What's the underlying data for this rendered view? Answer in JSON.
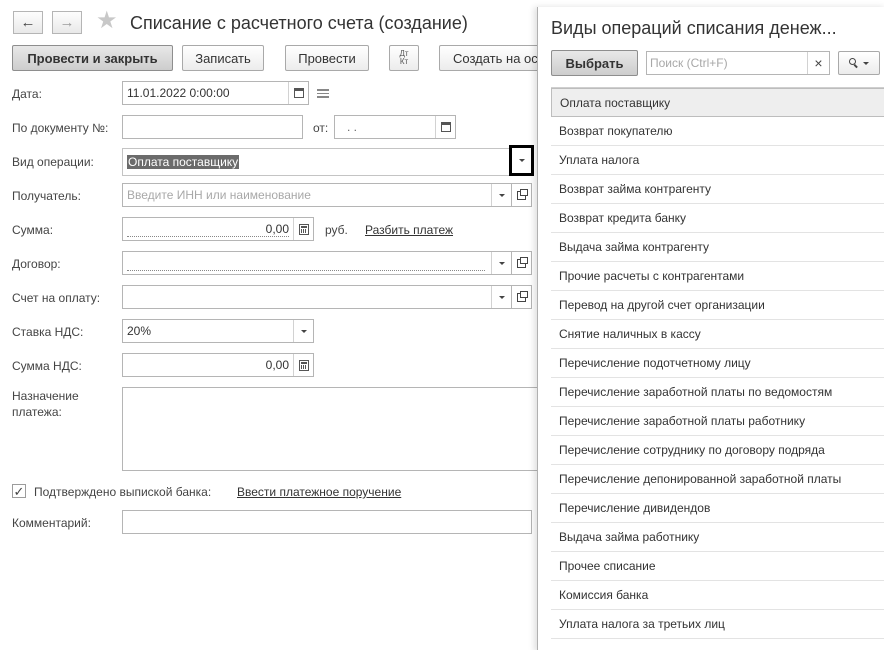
{
  "header": {
    "title": "Списание с расчетного счета (создание)",
    "back_icon": "←",
    "forward_icon": "→"
  },
  "toolbar": {
    "post_and_close": "Провести и закрыть",
    "save": "Записать",
    "post": "Провести",
    "dt_label": "Дт",
    "kt_label": "Кт",
    "create_based_on": "Создать на ос"
  },
  "form": {
    "date_label": "Дата:",
    "date_value": "11.01.2022  0:00:00",
    "doc_number_label": "По документу №:",
    "doc_number_value": "",
    "from_label": "от:",
    "from_value": " .  .",
    "operation_label": "Вид операции:",
    "operation_value": "Оплата поставщику",
    "recipient_label": "Получатель:",
    "recipient_placeholder": "Введите ИНН или наименование",
    "amount_label": "Сумма:",
    "amount_value": "0,00",
    "currency": "руб.",
    "split_payment_link": "Разбить платеж",
    "contract_label": "Договор:",
    "invoice_label": "Счет на оплату:",
    "vat_rate_label": "Ставка НДС:",
    "vat_rate_value": "20%",
    "vat_amount_label": "Сумма НДС:",
    "vat_amount_value": "0,00",
    "purpose_label_line1": "Назначение",
    "purpose_label_line2": "платежа:",
    "confirmed_label": "Подтверждено выпиской банка:",
    "confirmed_checked": true,
    "enter_order_link": "Ввести платежное поручение",
    "comment_label": "Комментарий:"
  },
  "panel": {
    "title": "Виды операций списания денеж...",
    "select_button": "Выбрать",
    "search_placeholder": "Поиск (Ctrl+F)",
    "clear_icon": "×",
    "items": [
      "Оплата поставщику",
      "Возврат покупателю",
      "Уплата налога",
      "Возврат займа контрагенту",
      "Возврат кредита банку",
      "Выдача займа контрагенту",
      "Прочие расчеты с контрагентами",
      "Перевод на другой счет организации",
      "Снятие наличных в кассу",
      "Перечисление подотчетному лицу",
      "Перечисление заработной платы по ведомостям",
      "Перечисление заработной платы работнику",
      "Перечисление сотруднику по договору подряда",
      "Перечисление депонированной заработной платы",
      "Перечисление дивидендов",
      "Выдача займа работнику",
      "Прочее списание",
      "Комиссия банка",
      "Уплата налога за третьих лиц"
    ]
  },
  "colors": {
    "selection_highlight": "#6b6b6b",
    "focus_border": "#000000"
  }
}
